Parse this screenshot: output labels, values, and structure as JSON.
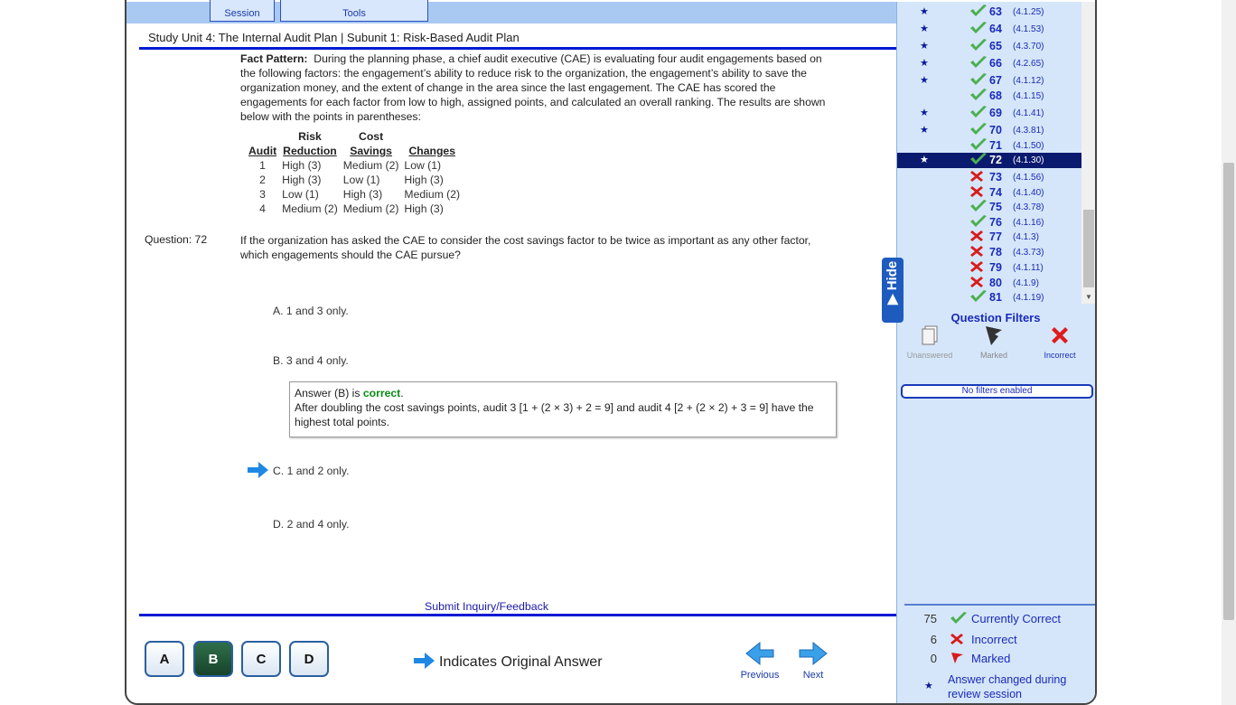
{
  "tabs": {
    "session": "Session",
    "tools": "Tools"
  },
  "unit_title": "Study Unit 4: The Internal Audit Plan | Subunit 1: Risk-Based Audit Plan",
  "fact_pattern": {
    "label": "Fact Pattern:",
    "text": "During the planning phase, a chief audit executive (CAE) is evaluating four audit engagements based on the following factors:  the engagement’s ability to reduce risk to the organization, the engagement’s ability to save the organization money, and the extent of change in the area since the last engagement. The CAE has scored the engagements for each factor from low to high, assigned points, and calculated an overall ranking. The results are shown below with the points in parentheses:"
  },
  "score_table": {
    "headers": {
      "audit": "Audit",
      "risk_top": "Risk",
      "risk_bottom": "Reduction",
      "cost_top": "Cost",
      "cost_bottom": "Savings",
      "changes": "Changes"
    },
    "rows": [
      {
        "audit": "1",
        "risk": "High (3)",
        "cost": "Medium (2)",
        "changes": "Low (1)"
      },
      {
        "audit": "2",
        "risk": "High (3)",
        "cost": "Low (1)",
        "changes": "High (3)"
      },
      {
        "audit": "3",
        "risk": "Low (1)",
        "cost": "High (3)",
        "changes": "Medium (2)"
      },
      {
        "audit": "4",
        "risk": "Medium (2)",
        "cost": "Medium (2)",
        "changes": "High (3)"
      }
    ]
  },
  "question": {
    "number_label": "Question: 72",
    "text": "If the organization has asked the CAE to consider the cost savings factor to be twice as important as any other factor, which engagements should the CAE pursue?"
  },
  "choices": {
    "a": "A. 1 and 3 only.",
    "b": "B. 3 and 4 only.",
    "c": "C. 1 and 2 only.",
    "d": "D. 2 and 4 only."
  },
  "answer": {
    "prefix": "Answer (B) is ",
    "status": "correct",
    "suffix": ".",
    "explanation": "After doubling the cost savings points, audit 3 [1 + (2 × 3) + 2 = 9] and audit 4 [2 + (2 × 2) + 3 = 9] have the highest total points."
  },
  "inquiry_link": "Submit Inquiry/Feedback",
  "answer_buttons": [
    "A",
    "B",
    "C",
    "D"
  ],
  "selected_button": "B",
  "indicates_original": "Indicates Original Answer",
  "nav": {
    "previous": "Previous",
    "next": "Next"
  },
  "hide_tab": "▶ Hide",
  "question_list": [
    {
      "num": "63",
      "ref": "(4.1.25)",
      "star": true,
      "status": "correct"
    },
    {
      "num": "64",
      "ref": "(4.1.53)",
      "star": true,
      "status": "correct"
    },
    {
      "num": "65",
      "ref": "(4.3.70)",
      "star": true,
      "status": "correct"
    },
    {
      "num": "66",
      "ref": "(4.2.65)",
      "star": true,
      "status": "correct"
    },
    {
      "num": "67",
      "ref": "(4.1.12)",
      "star": true,
      "status": "correct"
    },
    {
      "num": "68",
      "ref": "(4.1.15)",
      "star": false,
      "status": "correct"
    },
    {
      "num": "69",
      "ref": "(4.1.41)",
      "star": true,
      "status": "correct"
    },
    {
      "num": "70",
      "ref": "(4.3.81)",
      "star": true,
      "status": "correct"
    },
    {
      "num": "71",
      "ref": "(4.1.50)",
      "star": false,
      "status": "correct"
    },
    {
      "num": "72",
      "ref": "(4.1.30)",
      "star": true,
      "status": "correct",
      "active": true
    },
    {
      "num": "73",
      "ref": "(4.1.56)",
      "star": false,
      "status": "incorrect"
    },
    {
      "num": "74",
      "ref": "(4.1.40)",
      "star": false,
      "status": "incorrect"
    },
    {
      "num": "75",
      "ref": "(4.3.78)",
      "star": false,
      "status": "correct"
    },
    {
      "num": "76",
      "ref": "(4.1.16)",
      "star": false,
      "status": "correct"
    },
    {
      "num": "77",
      "ref": "(4.1.3)",
      "star": false,
      "status": "incorrect"
    },
    {
      "num": "78",
      "ref": "(4.3.73)",
      "star": false,
      "status": "incorrect"
    },
    {
      "num": "79",
      "ref": "(4.1.11)",
      "star": false,
      "status": "incorrect"
    },
    {
      "num": "80",
      "ref": "(4.1.9)",
      "star": false,
      "status": "incorrect"
    },
    {
      "num": "81",
      "ref": "(4.1.19)",
      "star": false,
      "status": "correct"
    }
  ],
  "question_filters": {
    "title": "Question Filters",
    "unanswered": "Unanswered",
    "marked": "Marked",
    "incorrect": "Incorrect",
    "status": "No filters enabled"
  },
  "legend": {
    "correct_count": "75",
    "correct_label": "Currently Correct",
    "incorrect_count": "6",
    "incorrect_label": "Incorrect",
    "marked_count": "0",
    "marked_label": "Marked",
    "changed_label": "Answer changed during review session"
  },
  "colors": {
    "accent_blue": "#0019d4",
    "correct_green": "#4caf50",
    "incorrect_red": "#d81b1b",
    "sidebar_bg": "#d5e6fa",
    "active_row": "#0a1a6e"
  }
}
